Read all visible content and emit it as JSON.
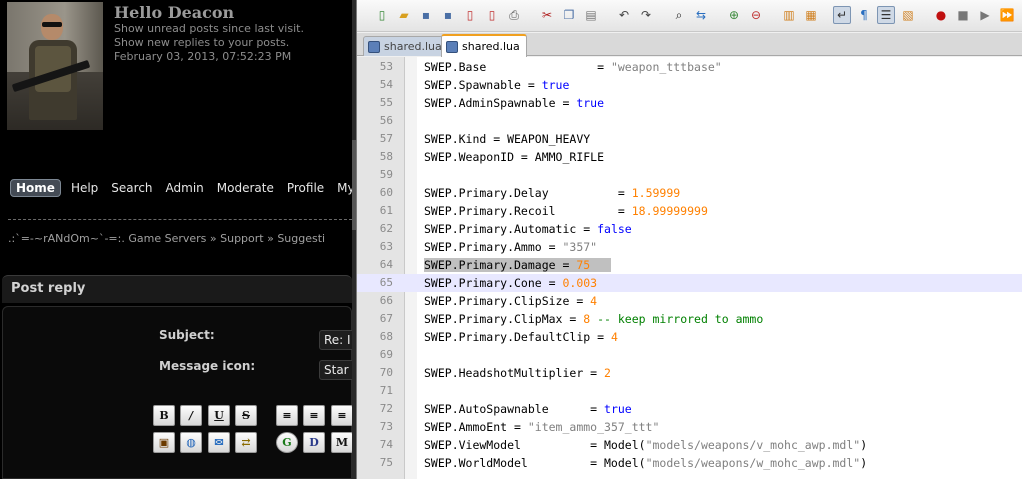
{
  "forum": {
    "greeting": {
      "title": "Hello Deacon",
      "unread": "Show unread posts since last visit.",
      "replies": "Show new replies to your posts.",
      "datetime": "February 03, 2013, 07:52:23 PM"
    },
    "nav": [
      "Home",
      "Help",
      "Search",
      "Admin",
      "Moderate",
      "Profile",
      "My M"
    ],
    "breadcrumb": ".:`=-~rANdOm~`-=:. Game Servers » Support » Suggesti",
    "post_reply": "Post reply",
    "subject_label": "Subject:",
    "subject_value": "Re: I",
    "message_icon_label": "Message icon:",
    "message_icon_value": "Star",
    "format_buttons_row1": [
      "B",
      "I",
      "U",
      "S",
      "≡",
      "≡",
      "≡"
    ],
    "format_buttons_row2": [
      "img",
      "globe",
      "email",
      "ftp",
      "G",
      "D",
      "M"
    ]
  },
  "editor": {
    "tabs": [
      {
        "label": "shared.lua",
        "active": false
      },
      {
        "label": "shared.lua",
        "active": true
      }
    ],
    "current_line": 65,
    "lines": [
      {
        "n": "53",
        "t": [
          [
            "SWEP.Base                = ",
            ""
          ],
          [
            "\"weapon_tttbase\"",
            "str"
          ]
        ]
      },
      {
        "n": "54",
        "t": [
          [
            "SWEP.Spawnable = ",
            ""
          ],
          [
            "true",
            "kw"
          ]
        ]
      },
      {
        "n": "55",
        "t": [
          [
            "SWEP.AdminSpawnable = ",
            ""
          ],
          [
            "true",
            "kw"
          ]
        ]
      },
      {
        "n": "56",
        "t": []
      },
      {
        "n": "57",
        "t": [
          [
            "SWEP.Kind = WEAPON_HEAVY",
            ""
          ]
        ]
      },
      {
        "n": "58",
        "t": [
          [
            "SWEP.WeaponID = AMMO_RIFLE",
            ""
          ]
        ]
      },
      {
        "n": "59",
        "t": []
      },
      {
        "n": "60",
        "t": [
          [
            "SWEP.Primary.Delay          = ",
            ""
          ],
          [
            "1.59999",
            "numv"
          ]
        ]
      },
      {
        "n": "61",
        "t": [
          [
            "SWEP.Primary.Recoil         = ",
            ""
          ],
          [
            "18.99999999",
            "numv"
          ]
        ]
      },
      {
        "n": "62",
        "t": [
          [
            "SWEP.Primary.Automatic = ",
            ""
          ],
          [
            "false",
            "kw"
          ]
        ]
      },
      {
        "n": "63",
        "t": [
          [
            "SWEP.Primary.Ammo = ",
            ""
          ],
          [
            "\"357\"",
            "str"
          ]
        ]
      },
      {
        "n": "64",
        "t": [
          [
            "SWEP.Primary.Damage = ",
            "sel"
          ],
          [
            "75",
            "numv sel"
          ],
          [
            "   ",
            "sel"
          ]
        ]
      },
      {
        "n": "65",
        "t": [
          [
            "SWEP.Primary.Cone = ",
            ""
          ],
          [
            "0.003",
            "numv"
          ]
        ]
      },
      {
        "n": "66",
        "t": [
          [
            "SWEP.Primary.ClipSize = ",
            ""
          ],
          [
            "4",
            "numv"
          ]
        ]
      },
      {
        "n": "67",
        "t": [
          [
            "SWEP.Primary.ClipMax = ",
            ""
          ],
          [
            "8",
            "numv"
          ],
          [
            " -- keep mirrored to ammo",
            "cmt"
          ]
        ]
      },
      {
        "n": "68",
        "t": [
          [
            "SWEP.Primary.DefaultClip = ",
            ""
          ],
          [
            "4",
            "numv"
          ]
        ]
      },
      {
        "n": "69",
        "t": []
      },
      {
        "n": "70",
        "t": [
          [
            "SWEP.HeadshotMultiplier = ",
            ""
          ],
          [
            "2",
            "numv"
          ]
        ]
      },
      {
        "n": "71",
        "t": []
      },
      {
        "n": "72",
        "t": [
          [
            "SWEP.AutoSpawnable      = ",
            ""
          ],
          [
            "true",
            "kw"
          ]
        ]
      },
      {
        "n": "73",
        "t": [
          [
            "SWEP.AmmoEnt = ",
            ""
          ],
          [
            "\"item_ammo_357_ttt\"",
            "str"
          ]
        ]
      },
      {
        "n": "74",
        "t": [
          [
            "SWEP.ViewModel          = Model(",
            ""
          ],
          [
            "\"models/weapons/v_mohc_awp.mdl\"",
            "str"
          ],
          [
            ")",
            ""
          ]
        ]
      },
      {
        "n": "75",
        "t": [
          [
            "SWEP.WorldModel         = Model(",
            ""
          ],
          [
            "\"models/weapons/w_mohc_awp.mdl\"",
            "str"
          ],
          [
            ")",
            ""
          ]
        ]
      }
    ],
    "colors": {
      "keyword": "#0000ff",
      "number": "#ff8000",
      "string": "#808080",
      "comment": "#008000",
      "current_line": "#e8e8ff"
    }
  }
}
